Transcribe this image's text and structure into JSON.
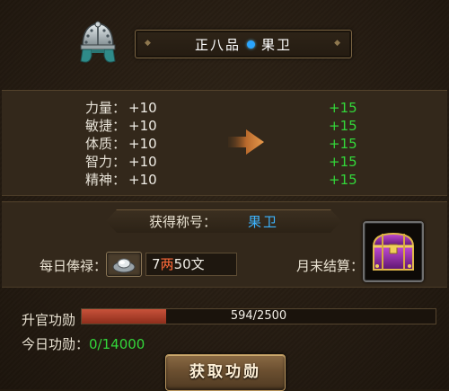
{
  "header": {
    "rank": "正八品",
    "title": "果卫"
  },
  "stats": [
    {
      "label": "力量：",
      "current": "+10",
      "next": "+15"
    },
    {
      "label": "敏捷：",
      "current": "+10",
      "next": "+15"
    },
    {
      "label": "体质：",
      "current": "+10",
      "next": "+15"
    },
    {
      "label": "智力：",
      "current": "+10",
      "next": "+15"
    },
    {
      "label": "精神：",
      "current": "+10",
      "next": "+15"
    }
  ],
  "earn_title": {
    "label": "获得称号：",
    "value": "果卫"
  },
  "salary": {
    "label": "每日俸禄：",
    "amount_liang": "7",
    "unit_liang": "两",
    "amount_wen": "50",
    "unit_wen": "文"
  },
  "month_end": {
    "label": "月末结算："
  },
  "merit": {
    "label": "升官功勋",
    "current": 594,
    "max": 2500,
    "text": "594/2500"
  },
  "today_merit": {
    "label": "今日功勋：",
    "value": "0/14000"
  },
  "button": {
    "label": "获取功勋"
  },
  "colors": {
    "green": "#33d63a",
    "blue": "#3db4ff",
    "bar_fill": "#c8523a"
  },
  "icons": {
    "helmet": "helmet-icon",
    "arrow": "arrow-right-icon",
    "silver": "silver-ingot-icon",
    "chest": "treasure-chest-icon"
  }
}
